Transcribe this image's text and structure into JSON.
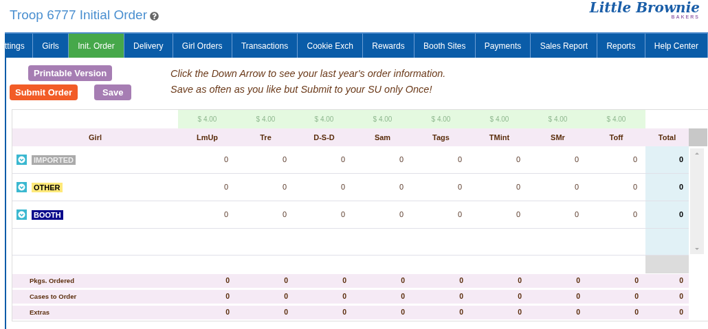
{
  "title": "Troop 6777 Initial Order",
  "logo": {
    "name": "Little Brownie",
    "sub": "BAKERS"
  },
  "tabs": [
    {
      "label": "ttings",
      "selected": false
    },
    {
      "label": "Girls",
      "selected": false
    },
    {
      "label": "Init. Order",
      "selected": true
    },
    {
      "label": "Delivery",
      "selected": false
    },
    {
      "label": "Girl Orders",
      "selected": false
    },
    {
      "label": "Transactions",
      "selected": false
    },
    {
      "label": "Cookie Exch",
      "selected": false
    },
    {
      "label": "Rewards",
      "selected": false
    },
    {
      "label": "Booth Sites",
      "selected": false
    },
    {
      "label": "Payments",
      "selected": false
    },
    {
      "label": "Sales Report",
      "selected": false
    },
    {
      "label": "Reports",
      "selected": false
    },
    {
      "label": "Help Center",
      "selected": false
    }
  ],
  "buttons": {
    "printable": "Printable Version",
    "submit": "Submit Order",
    "save": "Save"
  },
  "instructions": [
    "Click the Down Arrow to see your last year's order information.",
    "Save as often as you like but Submit to your SU only Once!"
  ],
  "table": {
    "prices": [
      "$ 4.00",
      "$ 4.00",
      "$ 4.00",
      "$ 4.00",
      "$ 4.00",
      "$ 4.00",
      "$ 4.00",
      "$ 4.00"
    ],
    "columns": [
      "Girl",
      "LmUp",
      "Tre",
      "D-S-D",
      "Sam",
      "Tags",
      "TMint",
      "SMr",
      "Toff",
      "Total"
    ],
    "rows": [
      {
        "label": "IMPORTED",
        "kind": "imported",
        "values": [
          "0",
          "0",
          "0",
          "0",
          "0",
          "0",
          "0",
          "0"
        ],
        "total": "0"
      },
      {
        "label": "OTHER",
        "kind": "other",
        "values": [
          "0",
          "0",
          "0",
          "0",
          "0",
          "0",
          "0",
          "0"
        ],
        "total": "0"
      },
      {
        "label": "BOOTH",
        "kind": "booth",
        "values": [
          "0",
          "0",
          "0",
          "0",
          "0",
          "0",
          "0",
          "0"
        ],
        "total": "0"
      }
    ],
    "summary": [
      {
        "label": "Pkgs. Ordered",
        "values": [
          "0",
          "0",
          "0",
          "0",
          "0",
          "0",
          "0",
          "0"
        ],
        "total": "0"
      },
      {
        "label": "Cases to Order",
        "values": [
          "0",
          "0",
          "0",
          "0",
          "0",
          "0",
          "0",
          "0"
        ],
        "total": "0"
      },
      {
        "label": "Extras",
        "values": [
          "0",
          "0",
          "0",
          "0",
          "0",
          "0",
          "0",
          "0"
        ],
        "total": "0"
      }
    ]
  }
}
